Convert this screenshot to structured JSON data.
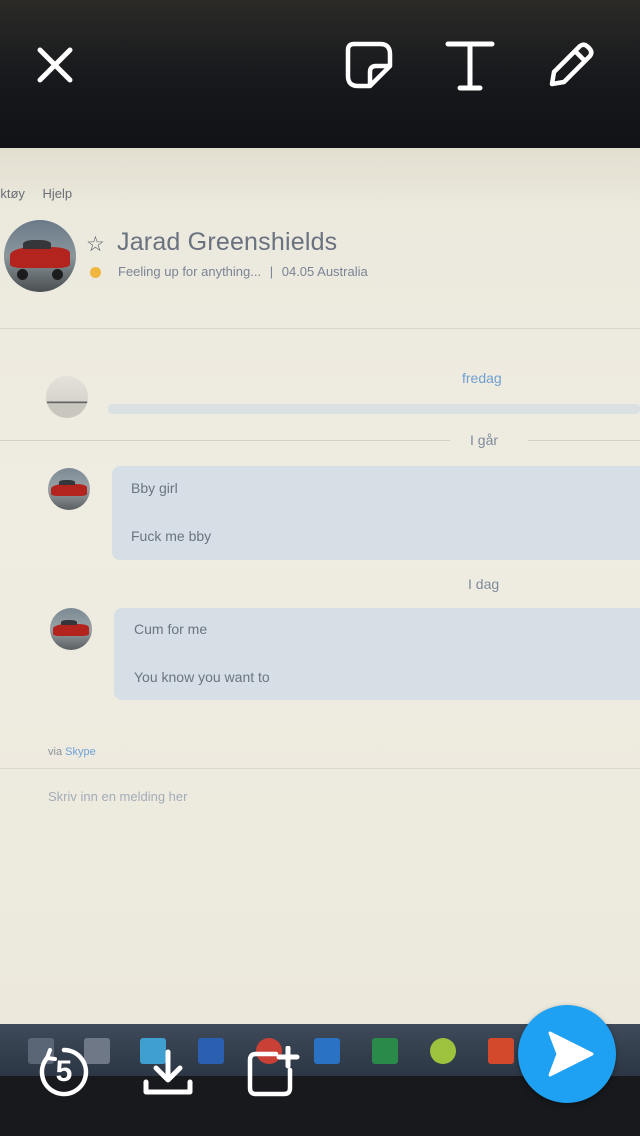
{
  "chat_window": {
    "menu_items": [
      "rktøy",
      "Hjelp"
    ],
    "contact": {
      "name": "Jarad Greenshields",
      "mood": "Feeling up for anything...",
      "separator": "|",
      "local_info": "04.05 Australia"
    },
    "days": {
      "friday": "fredag",
      "yesterday": "I går",
      "today": "I dag"
    },
    "messages_yesterday": [
      "Bby girl",
      "Fuck me bby"
    ],
    "messages_today": [
      "Cum for me",
      "You know you want to"
    ],
    "via_prefix": "via",
    "via_service": "Skype",
    "input_placeholder": "Skriv inn en melding her"
  },
  "snap_overlay": {
    "timer_value": "5",
    "accent_color": "#1ea1f2",
    "icons": {
      "close": "close-icon",
      "sticker": "sticker-icon",
      "text": "text-icon",
      "draw": "pencil-icon",
      "timer": "timer-icon",
      "save": "download-icon",
      "story": "add-story-icon",
      "send": "send-arrow-icon"
    }
  }
}
